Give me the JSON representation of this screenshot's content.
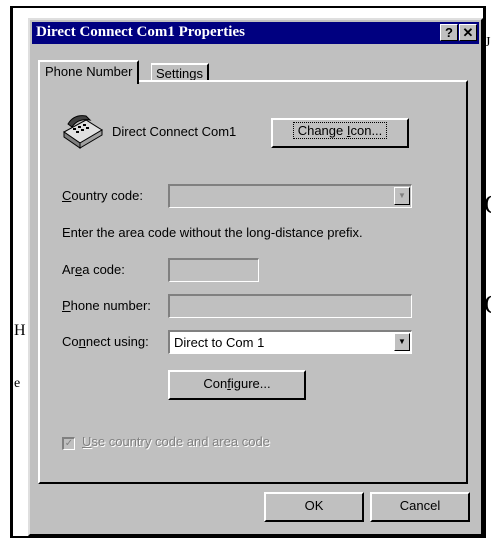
{
  "dialog": {
    "title": "Direct Connect Com1 Properties",
    "help_button": "?",
    "close_button": "✕"
  },
  "tabs": [
    {
      "label": "Phone Number",
      "active": true
    },
    {
      "label": "Settings",
      "active": false
    }
  ],
  "connection": {
    "name": "Direct Connect Com1",
    "change_icon_label_pre": "Change ",
    "change_icon_label_u": "I",
    "change_icon_label_post": "con..."
  },
  "country": {
    "label_u": "C",
    "label_rest": "ountry code:",
    "value": ""
  },
  "instructions": "Enter the area code without the long-distance prefix.",
  "area": {
    "label_pre": "Ar",
    "label_u": "e",
    "label_post": "a code:",
    "value": ""
  },
  "phone": {
    "label_u": "P",
    "label_rest": "hone number:",
    "value": ""
  },
  "connect": {
    "label_pre": "Co",
    "label_u": "n",
    "label_post": "nect using:",
    "value": "Direct to Com 1"
  },
  "configure": {
    "label_pre": "Con",
    "label_u": "f",
    "label_post": "igure..."
  },
  "use_country": {
    "label_u": "U",
    "label_rest": "se country code and area code",
    "checked": true
  },
  "footer": {
    "ok_label": "OK",
    "cancel_label": "Cancel"
  },
  "background": {
    "glyph_c1": "C",
    "glyph_c2": "C",
    "glyph_h": "H",
    "glyph_e": "e",
    "glyph_j": "J"
  }
}
